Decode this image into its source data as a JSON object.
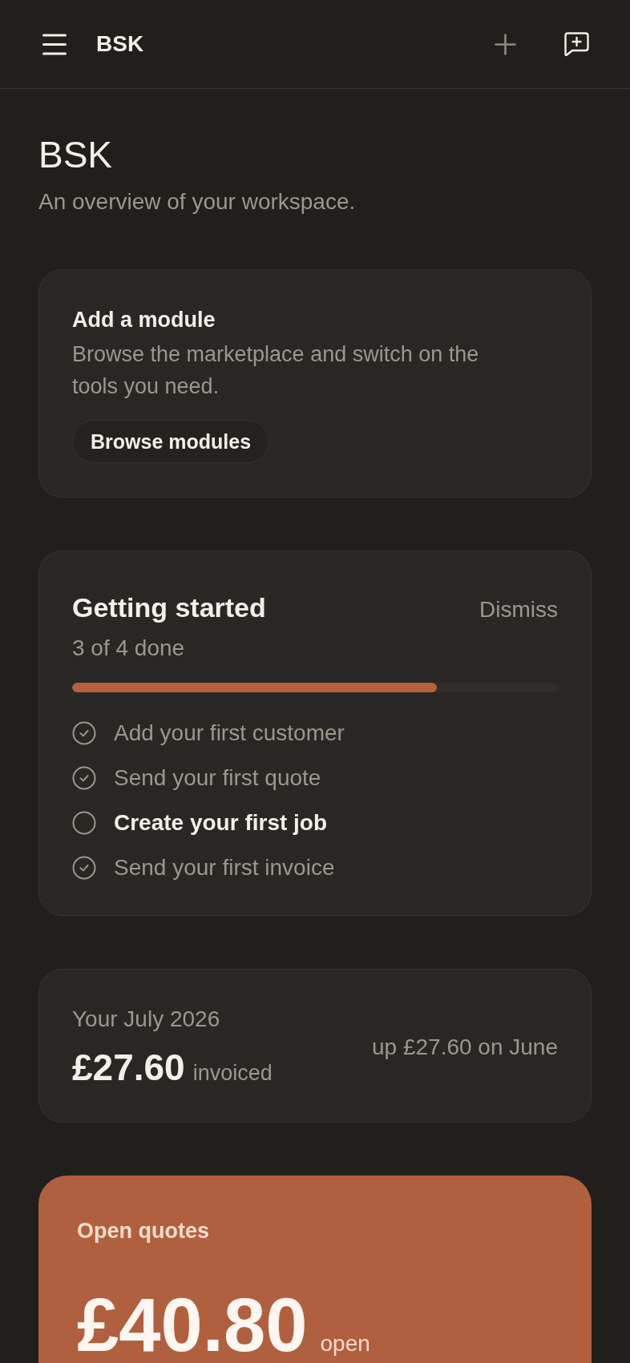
{
  "header": {
    "title": "BSK"
  },
  "page": {
    "title": "BSK",
    "subtitle": "An overview of your workspace."
  },
  "module_card": {
    "title": "Add a module",
    "description": "Browse the marketplace and switch on the tools you need.",
    "button": "Browse modules"
  },
  "getting_started": {
    "title": "Getting started",
    "dismiss": "Dismiss",
    "progress_text": "3 of 4 done",
    "level": 0.75,
    "tasks": [
      {
        "label": "Add your first customer",
        "checked": true
      },
      {
        "label": "Send your first quote",
        "checked": true
      },
      {
        "label": "Create your first job",
        "checked": false
      },
      {
        "label": "Send your first invoice",
        "checked": true
      }
    ]
  },
  "monthly_summary": {
    "period": "Your July 2026",
    "amount": "£27.60",
    "amount_label": "invoiced",
    "comparison": "up £27.60 on June"
  },
  "open_quotes": {
    "title": "Open quotes",
    "amount": "£40.80",
    "amount_label": "open"
  }
}
